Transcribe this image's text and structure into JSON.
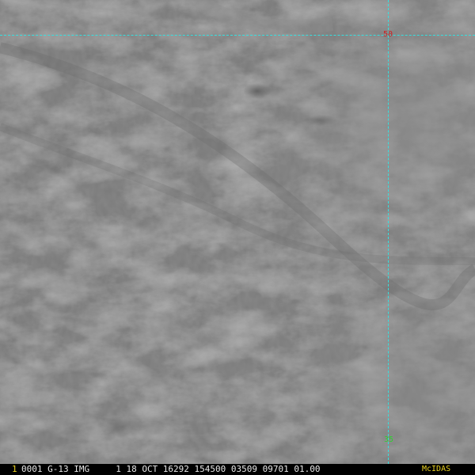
{
  "image": {
    "subject": "cloud",
    "palette": {
      "base": "#7b7b7b",
      "light": "#8a8a8a",
      "dark": "#626262"
    }
  },
  "gridlines": {
    "color": "#35e0e0",
    "latitude_label": "50",
    "latitude_label_color": "#d02020",
    "longitude_label": "35",
    "longitude_label_color": "#30d030"
  },
  "status_bar": {
    "frame": "1",
    "header": "0001 G-13 IMG     1 18 OCT 16292 154500 03509 09701 01.00",
    "software": "McIDAS",
    "accent_color": "#e8d020"
  }
}
